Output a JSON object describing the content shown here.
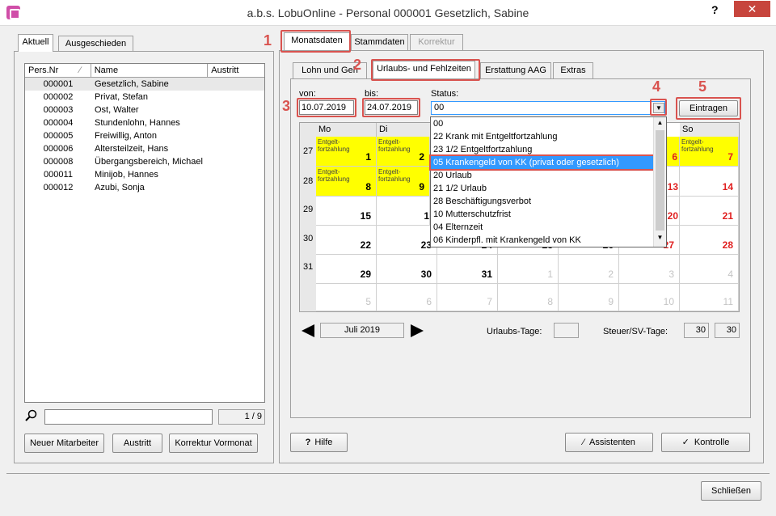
{
  "window": {
    "title": "a.b.s. LobuOnline - Personal 000001 Gesetzlich, Sabine",
    "help": "?",
    "close": "✕"
  },
  "left": {
    "tabs": [
      "Aktuell",
      "Ausgeschieden"
    ],
    "columns": [
      "Pers.Nr",
      "Name",
      "Austritt"
    ],
    "rows": [
      {
        "nr": "000001",
        "name": "Gesetzlich, Sabine"
      },
      {
        "nr": "000002",
        "name": "Privat, Stefan"
      },
      {
        "nr": "000003",
        "name": "Ost, Walter"
      },
      {
        "nr": "000004",
        "name": "Stundenlohn, Hannes"
      },
      {
        "nr": "000005",
        "name": "Freiwillig, Anton"
      },
      {
        "nr": "000006",
        "name": "Altersteilzeit, Hans"
      },
      {
        "nr": "000008",
        "name": "Übergangsbereich, Michael"
      },
      {
        "nr": "000011",
        "name": "Minijob, Hannes"
      },
      {
        "nr": "000012",
        "name": "Azubi, Sonja"
      }
    ],
    "count": "1 / 9",
    "buttons": [
      "Neuer Mitarbeiter",
      "Austritt",
      "Korrektur Vormonat"
    ]
  },
  "right": {
    "tabs": [
      "Monatsdaten",
      "Stammdaten",
      "Korrektur"
    ],
    "subtabs": [
      "Lohn und Geh",
      "Urlaubs- und Fehlzeiten",
      "Erstattung AAG",
      "Extras"
    ],
    "von_label": "von:",
    "von": "10.07.2019",
    "bis_label": "bis:",
    "bis": "24.07.2019",
    "status_label": "Status:",
    "status": "00",
    "eintragen": "Eintragen",
    "callouts": [
      "1",
      "2",
      "3",
      "4",
      "5"
    ],
    "weekdays": [
      "Mo",
      "Di",
      "So"
    ],
    "weeks": [
      "27",
      "28",
      "29",
      "30",
      "31"
    ],
    "entgelt": "Entgelt-\nfortzahlung",
    "days": {
      "w27": [
        "1",
        "2",
        "6",
        "7"
      ],
      "w28": [
        "8",
        "9",
        "13",
        "14"
      ],
      "w29": [
        "15",
        "1",
        "20",
        "21"
      ],
      "w30": [
        "22",
        "23",
        "24",
        "25",
        "26",
        "27",
        "28"
      ],
      "w31": [
        "29",
        "30",
        "31",
        "1",
        "2",
        "3",
        "4"
      ],
      "w32": [
        "5",
        "6",
        "7",
        "8",
        "9",
        "10",
        "11"
      ]
    },
    "dropdown": [
      "00",
      "22 Krank mit Entgeltfortzahlung",
      "23 1/2 Entgeltfortzahlung",
      "05 Krankengeld von KK (privat oder gesetzlich)",
      "20 Urlaub",
      "21 1/2 Urlaub",
      "28 Beschäftigungsverbot",
      "10 Mutterschutzfrist",
      "04 Elternzeit",
      "06 Kinderpfl. mit Krankengeld von KK"
    ],
    "month": "Juli 2019",
    "urlaubs_label": "Urlaubs-Tage:",
    "steuer_label": "Steuer/SV-Tage:",
    "steuer1": "30",
    "steuer2": "30",
    "hilfe": "Hilfe",
    "assistenten": "Assistenten",
    "kontrolle": "Kontrolle"
  },
  "footer": {
    "close": "Schließen"
  }
}
